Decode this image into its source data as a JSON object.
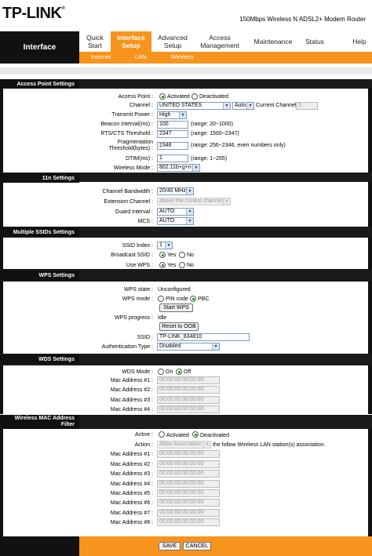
{
  "header": {
    "logo": "TP-LINK",
    "logo_mark": "®",
    "model": "150Mbps Wireless N ADSL2+ Modem Router"
  },
  "nav": {
    "brand": "Interface",
    "items": [
      {
        "label_1": "Quick",
        "label_2": "Start"
      },
      {
        "label_1": "Interface",
        "label_2": "Setup"
      },
      {
        "label_1": "Advanced",
        "label_2": "Setup"
      },
      {
        "label_1": "Access",
        "label_2": "Management"
      },
      {
        "label_1": "Maintenance",
        "label_2": ""
      },
      {
        "label_1": "Status",
        "label_2": ""
      },
      {
        "label_1": "Help",
        "label_2": ""
      }
    ],
    "sub": [
      "Internet",
      "LAN",
      "Wireless"
    ]
  },
  "ap": {
    "title": "Access Point Settings",
    "access_point_label": "Access Point :",
    "activated": "Activated",
    "deactivated": "Deactivated",
    "channel_label": "Channel :",
    "channel_country": "UNITED STATES",
    "channel_value": "Auto",
    "current_channel_label": "Current Channel :",
    "current_channel_value": "3",
    "tx_power_label": "Transmit Power :",
    "tx_power_value": "High",
    "beacon_label": "Beacon Interval(ms) :",
    "beacon_value": "100",
    "beacon_range": "(range: 20~1000)",
    "rts_label": "RTS/CTS Threshold :",
    "rts_value": "2347",
    "rts_range": "(range: 1500~2347)",
    "frag_label_1": "Fragmentation",
    "frag_label_2": "Threshold(bytes) :",
    "frag_value": "2346",
    "frag_range": "(range: 256~2346, even numbers only)",
    "dtim_label": "DTIM(ms) :",
    "dtim_value": "1",
    "dtim_range": "(range: 1~255)",
    "mode_label": "Wireless Mode :",
    "mode_value": "802.11b+g+n"
  },
  "n11": {
    "title": "11n Settings",
    "bw_label": "Channel Bandwidth :",
    "bw_value": "20/40 MHz",
    "ext_label": "Extension Channel :",
    "ext_value": "above the control channel",
    "gi_label": "Guard Interval :",
    "gi_value": "AUTO",
    "mcs_label": "MCS :",
    "mcs_value": "AUTO"
  },
  "ssid": {
    "title": "Multiple SSIDs Settings",
    "index_label": "SSID Index :",
    "index_value": "1",
    "broadcast_label": "Broadcast SSID :",
    "use_wps_label": "Use WPS :",
    "yes": "Yes",
    "no": "No"
  },
  "wps": {
    "title": "WPS Settings",
    "state_label": "WPS state :",
    "state_value": "Unconfigured",
    "mode_label": "WPS mode :",
    "pin": "PIN code",
    "pbc": "PBC",
    "start_button": "Start WPS",
    "progress_label": "WPS progress :",
    "progress_value": "Idle",
    "reset_button": "Reset to OOB",
    "ssid_label": "SSID :",
    "ssid_value": "TP-LINK_834810",
    "auth_label": "Authentication Type :",
    "auth_value": "Disabled"
  },
  "wds": {
    "title": "WDS Settings",
    "mode_label": "WDS Mode :",
    "on": "On",
    "off": "Off",
    "mac_labels": [
      "Mac Address #1 :",
      "Mac Address #2 :",
      "Mac Address #3 :",
      "Mac Address #4 :"
    ],
    "mac_value": "00:00:00:00:00:00"
  },
  "macf": {
    "title_1": "Wireless MAC Address",
    "title_2": "Filter",
    "active_label": "Active :",
    "activated": "Activated",
    "deactivated": "Deactivated",
    "action_label": "Action :",
    "action_value": "Allow Association",
    "action_suffix": "the follow Wireless LAN station(s) association.",
    "mac_labels": [
      "Mac Address #1 :",
      "Mac Address #2 :",
      "Mac Address #3 :",
      "Mac Address #4 :",
      "Mac Address #5 :",
      "Mac Address #6 :",
      "Mac Address #7 :",
      "Mac Address #8 :"
    ],
    "mac_value": "00:00:00:00:00:00"
  },
  "footer": {
    "save": "SAVE",
    "cancel": "CANCEL"
  },
  "colors": {
    "accent": "#f7941d",
    "dark": "#111111"
  }
}
